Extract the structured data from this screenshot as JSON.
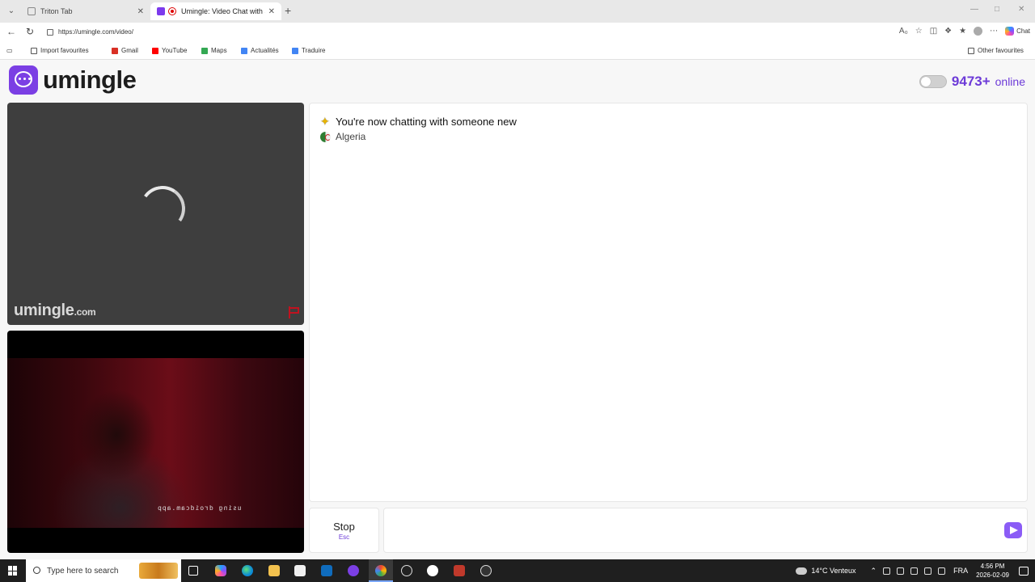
{
  "browser": {
    "tabs": [
      {
        "title": "Triton Tab",
        "active": false
      },
      {
        "title": "Umingle: Video Chat with Stra",
        "active": true
      }
    ],
    "url": "https://umingle.com/video/",
    "chat_button": "Chat",
    "bookmarks": [
      {
        "label": "Import favourites",
        "icon": "import-icon",
        "color": "#555555"
      },
      {
        "label": "Gmail",
        "icon": "gmail-icon",
        "color": "#d93025"
      },
      {
        "label": "YouTube",
        "icon": "youtube-icon",
        "color": "#ff0000"
      },
      {
        "label": "Maps",
        "icon": "maps-icon",
        "color": "#34a853"
      },
      {
        "label": "Actualités",
        "icon": "news-icon",
        "color": "#4285f4"
      },
      {
        "label": "Traduire",
        "icon": "translate-icon",
        "color": "#4285f4"
      }
    ],
    "other_favourites": "Other favourites"
  },
  "site": {
    "logo_text": "umingle",
    "brand_color": "#6d3bd8",
    "online_count": "9473+",
    "online_word": "online"
  },
  "video": {
    "remote_watermark": "umingle",
    "remote_watermark_domain": ".com",
    "local_caption": "using droidcam.app"
  },
  "chat": {
    "system_message": "You're now chatting with someone new",
    "country": "Algeria"
  },
  "controls": {
    "stop_label": "Stop",
    "stop_shortcut": "Esc",
    "message_placeholder": ""
  },
  "taskbar": {
    "search_placeholder": "Type here to search",
    "weather": "14°C Venteux",
    "language": "FRA",
    "time": "4:56 PM",
    "date": "2026-02-09"
  }
}
